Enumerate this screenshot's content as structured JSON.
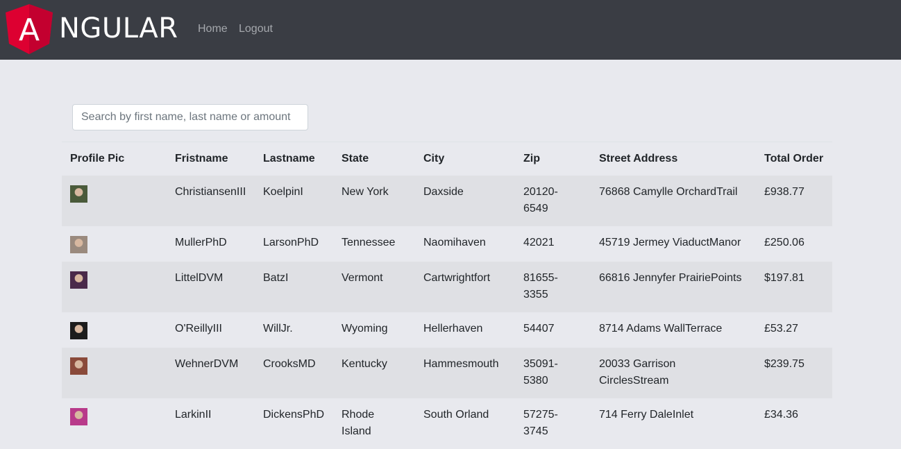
{
  "navbar": {
    "brand": "NGULAR",
    "logo_letter": "A",
    "links": [
      "Home",
      "Logout"
    ],
    "brand_color": "#dd0031"
  },
  "search": {
    "placeholder": "Search by first name, last name or amount",
    "value": ""
  },
  "table": {
    "headers": [
      "Profile Pic",
      "Fristname",
      "Lastname",
      "State",
      "City",
      "Zip",
      "Street Address",
      "Total Order"
    ],
    "rows": [
      {
        "avatar": "profile-pic",
        "avatar_color": "#4a5a3a",
        "first": "ChristiansenIII",
        "last": "KoelpinI",
        "state": "New York",
        "city": "Daxside",
        "zip": "20120-6549",
        "street": "76868 Camylle OrchardTrail",
        "total": "£938.77"
      },
      {
        "avatar": "profile-pic",
        "avatar_color": "#9a8a7e",
        "first": "MullerPhD",
        "last": "LarsonPhD",
        "state": "Tennessee",
        "city": "Naomihaven",
        "zip": "42021",
        "street": "45719 Jermey ViaductManor",
        "total": "£250.06"
      },
      {
        "avatar": "profile-pic",
        "avatar_color": "#4a2a4a",
        "first": "LittelDVM",
        "last": "BatzI",
        "state": "Vermont",
        "city": "Cartwrightfort",
        "zip": "81655-3355",
        "street": "66816 Jennyfer PrairiePoints",
        "total": "$197.81"
      },
      {
        "avatar": "profile-pic",
        "avatar_color": "#1c1c1c",
        "first": "O'ReillyIII",
        "last": "WillJr.",
        "state": "Wyoming",
        "city": "Hellerhaven",
        "zip": "54407",
        "street": "8714 Adams WallTerrace",
        "total": "£53.27"
      },
      {
        "avatar": "profile-pic",
        "avatar_color": "#8a4a3a",
        "first": "WehnerDVM",
        "last": "CrooksMD",
        "state": "Kentucky",
        "city": "Hammesmouth",
        "zip": "35091-5380",
        "street": "20033 Garrison CirclesStream",
        "total": "$239.75"
      },
      {
        "avatar": "profile-pic",
        "avatar_color": "#b83a8a",
        "first": "LarkinII",
        "last": "DickensPhD",
        "state": "Rhode Island",
        "city": "South Orland",
        "zip": "57275-3745",
        "street": "714 Ferry DaleInlet",
        "total": "£34.36"
      }
    ]
  }
}
